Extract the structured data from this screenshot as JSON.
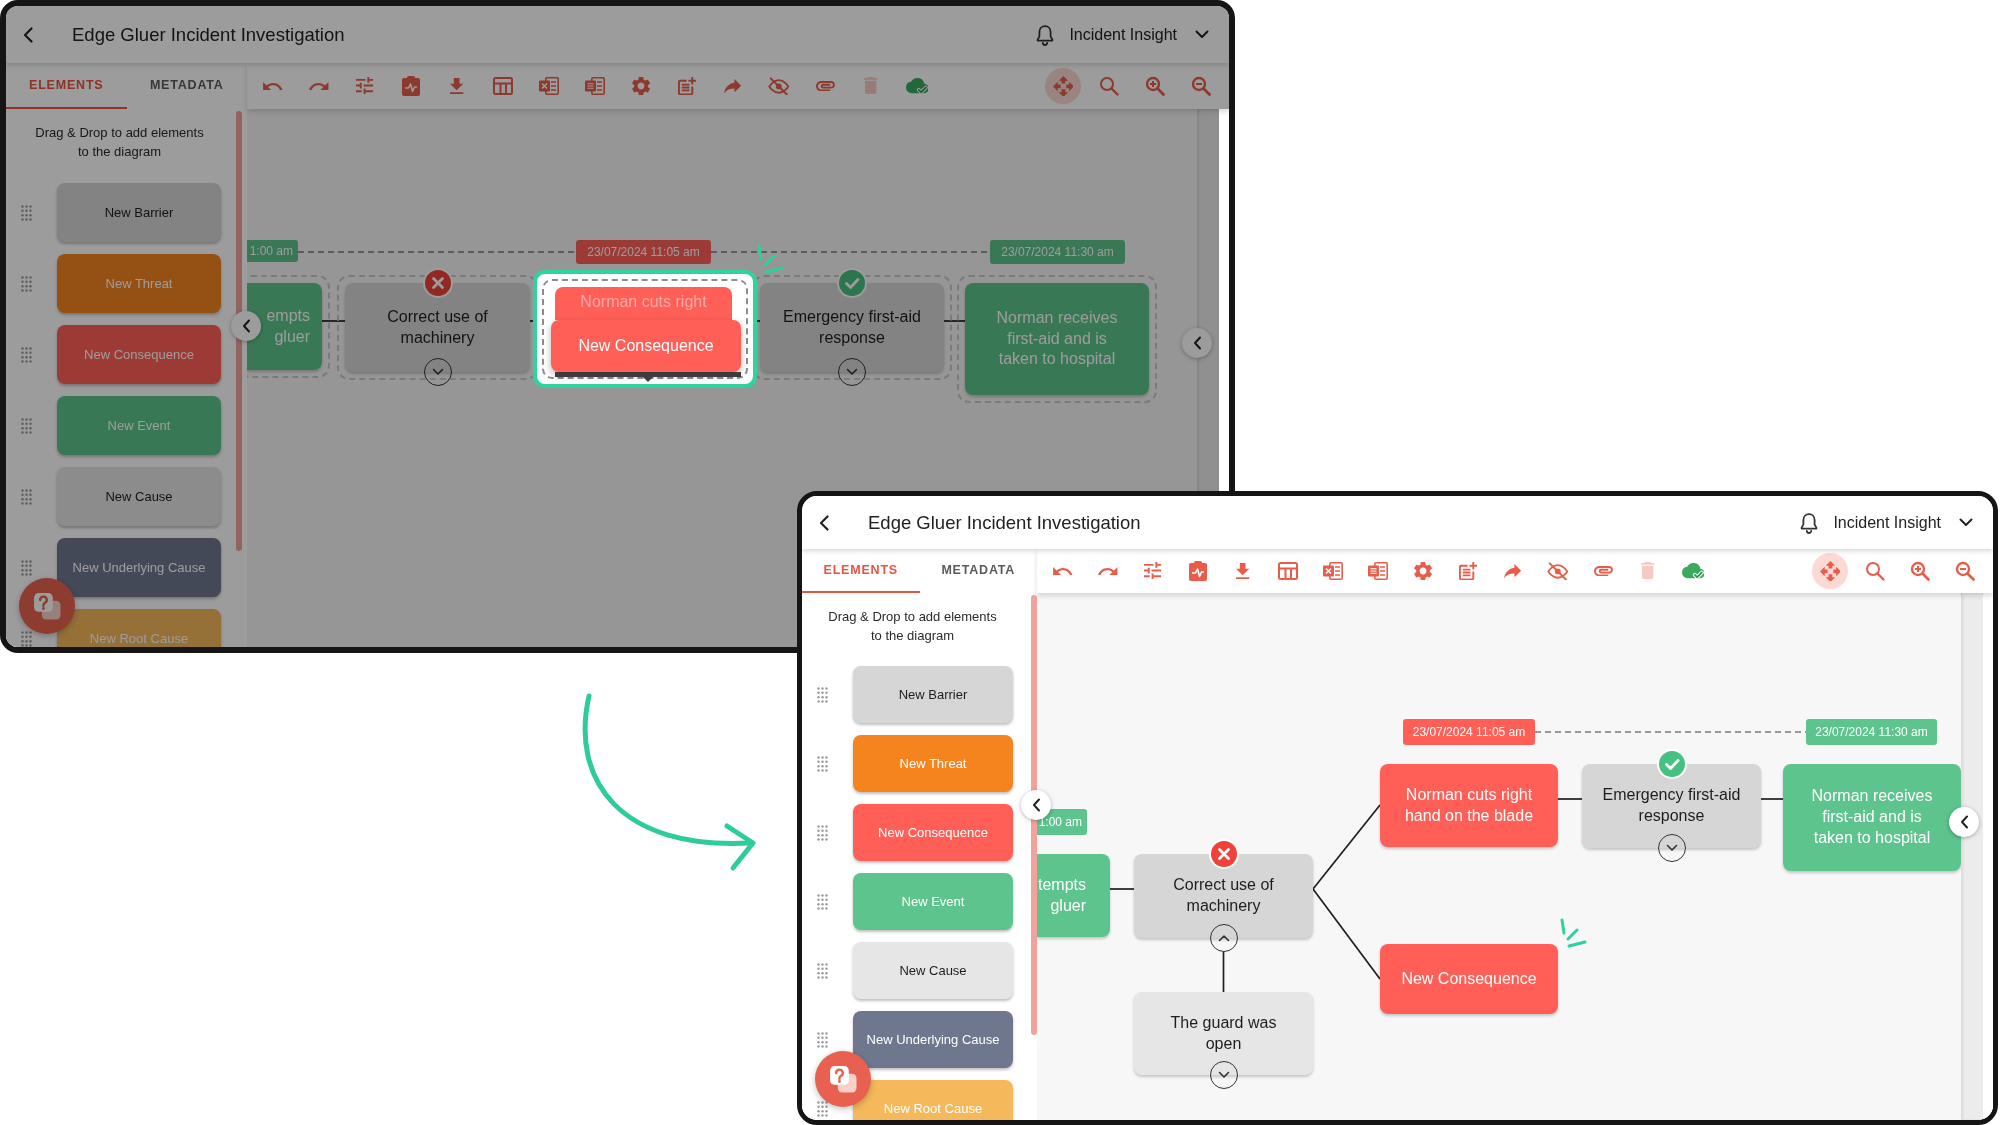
{
  "screens": [
    {
      "dragged_element": {
        "label": "New Consequence",
        "kind": "consequence"
      },
      "header": {
        "title": "Edge Gluer Incident Investigation",
        "account": "Incident Insight"
      },
      "tabs": [
        {
          "label": "ELEMENTS",
          "selected": true
        },
        {
          "label": "METADATA",
          "selected": false
        }
      ],
      "toolbar": {
        "pan_mode": true,
        "delete_disabled": true
      },
      "sidebar": {
        "hint": "Drag & Drop to add elements to the diagram",
        "elements": [
          {
            "label": "New Barrier",
            "kind": "barrier"
          },
          {
            "label": "New Threat",
            "kind": "threat"
          },
          {
            "label": "New Consequence",
            "kind": "consequence"
          },
          {
            "label": "New Event",
            "kind": "event"
          },
          {
            "label": "New Cause",
            "kind": "cause"
          },
          {
            "label": "New Underlying Cause",
            "kind": "underlying_cause"
          },
          {
            "label": "New Root Cause",
            "kind": "root_cause"
          }
        ]
      },
      "canvas": {
        "timeline": [
          {
            "label": "1:00 am",
            "kind": "event"
          },
          {
            "label": "23/07/2024 11:05 am",
            "kind": "consequence"
          },
          {
            "label": "23/07/2024 11:30 am",
            "kind": "event"
          }
        ],
        "nodes": [
          {
            "kind": "event",
            "text": "empts gluer",
            "drop_target": false
          },
          {
            "kind": "barrier",
            "text": "Correct use of machinery",
            "barrier_effective": false,
            "expanded": false,
            "drop_target": false
          },
          {
            "kind": "consequence",
            "text": "Norman cuts right",
            "drop_target": true
          },
          {
            "kind": "barrier",
            "text": "Emergency first-aid response",
            "barrier_effective": true,
            "expanded": false,
            "drop_target": false
          },
          {
            "kind": "event",
            "text": "Norman receives first-aid and is taken to hospital",
            "drop_target": false
          }
        ]
      }
    },
    {
      "header": {
        "title": "Edge Gluer Incident Investigation",
        "account": "Incident Insight"
      },
      "tabs": [
        {
          "label": "ELEMENTS",
          "selected": true
        },
        {
          "label": "METADATA",
          "selected": false
        }
      ],
      "toolbar": {
        "pan_mode": true,
        "delete_disabled": true
      },
      "sidebar": {
        "hint": "Drag & Drop to add elements to the diagram",
        "elements": [
          {
            "label": "New Barrier",
            "kind": "barrier"
          },
          {
            "label": "New Threat",
            "kind": "threat"
          },
          {
            "label": "New Consequence",
            "kind": "consequence"
          },
          {
            "label": "New Event",
            "kind": "event"
          },
          {
            "label": "New Cause",
            "kind": "cause"
          },
          {
            "label": "New Underlying Cause",
            "kind": "underlying_cause"
          },
          {
            "label": "New Root Cause",
            "kind": "root_cause"
          }
        ]
      },
      "canvas": {
        "timeline": [
          {
            "label": "1:00 am",
            "kind": "event"
          },
          {
            "label": "23/07/2024 11:05 am",
            "kind": "consequence"
          },
          {
            "label": "23/07/2024 11:30 am",
            "kind": "event"
          }
        ],
        "nodes": [
          {
            "kind": "event",
            "text": "tempts gluer",
            "just_added": false
          },
          {
            "kind": "barrier",
            "text": "Correct use of machinery",
            "barrier_effective": false,
            "expanded": true,
            "just_added": false,
            "children": [
              {
                "kind": "cause",
                "text": "The guard was open",
                "expanded": false
              }
            ]
          },
          {
            "kind": "consequence",
            "text": "Norman cuts right hand on the blade",
            "just_added": false
          },
          {
            "kind": "consequence",
            "text": "New Consequence",
            "just_added": true
          },
          {
            "kind": "barrier",
            "text": "Emergency first-aid response",
            "barrier_effective": true,
            "expanded": false,
            "just_added": false
          },
          {
            "kind": "event",
            "text": "Norman receives first-aid and is taken to hospital",
            "just_added": false
          }
        ]
      }
    }
  ]
}
